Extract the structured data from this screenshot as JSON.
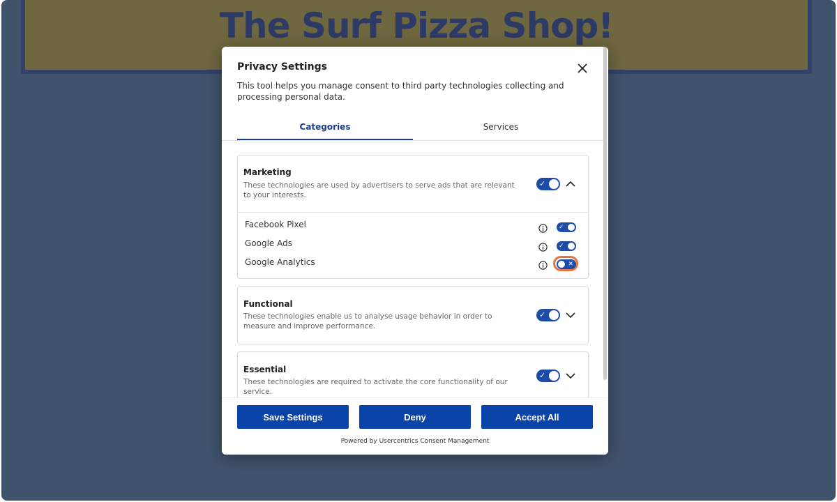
{
  "page": {
    "hero_title": "The Surf Pizza Shop!"
  },
  "modal": {
    "title": "Privacy Settings",
    "description": "This tool helps you manage consent to third party technologies collecting and processing personal data.",
    "close_icon": "close-icon"
  },
  "tabs": [
    {
      "label": "Categories",
      "active": true
    },
    {
      "label": "Services",
      "active": false
    }
  ],
  "categories": [
    {
      "title": "Marketing",
      "description": "These technologies are used by advertisers to serve ads that are relevant to your interests.",
      "enabled": true,
      "expanded": true,
      "services": [
        {
          "name": "Facebook Pixel",
          "enabled": true
        },
        {
          "name": "Google Ads",
          "enabled": true
        },
        {
          "name": "Google Analytics",
          "enabled": false,
          "focused": true
        }
      ]
    },
    {
      "title": "Functional",
      "description": "These technologies enable us to analyse usage behavior in order to measure and improve performance.",
      "enabled": true,
      "expanded": false
    },
    {
      "title": "Essential",
      "description": "These technologies are required to activate the core functionality of our service.",
      "enabled": true,
      "expanded": false
    }
  ],
  "footer": {
    "save_label": "Save Settings",
    "deny_label": "Deny",
    "accept_label": "Accept All",
    "powered_by": "Powered by Usercentrics Consent Management"
  },
  "colors": {
    "backdrop": "#40536c",
    "banner": "#6e673f",
    "accent": "#0a44a8",
    "focus_ring": "#e8713c"
  }
}
